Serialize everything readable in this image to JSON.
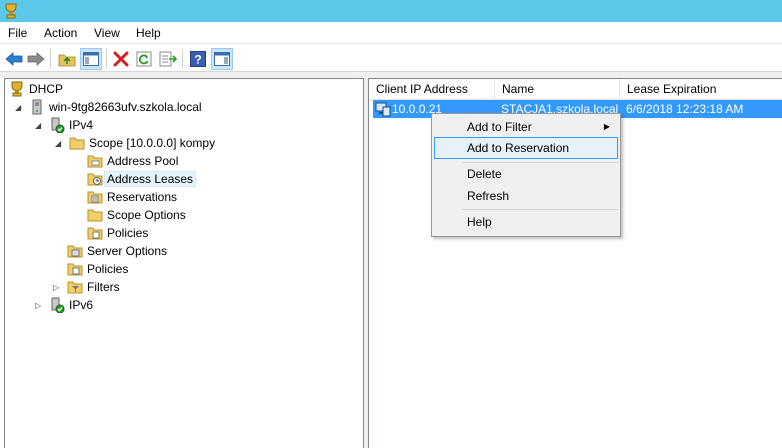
{
  "menubar": {
    "items": [
      "File",
      "Action",
      "View",
      "Help"
    ]
  },
  "toolbar": {
    "buttons": [
      "back-arrow-icon",
      "forward-arrow-icon",
      "up-folder-icon",
      "show-hide-tree-icon",
      "delete-icon",
      "refresh-icon",
      "export-list-icon",
      "help-icon",
      "action-pane-icon"
    ]
  },
  "tree": {
    "root": "DHCP",
    "server": "win-9tg82663ufv.szkola.local",
    "ipv4": "IPv4",
    "scope": "Scope [10.0.0.0] kompy",
    "address_pool": "Address Pool",
    "address_leases": "Address Leases",
    "reservations": "Reservations",
    "scope_options": "Scope Options",
    "scope_policies": "Policies",
    "server_options": "Server Options",
    "policies": "Policies",
    "filters": "Filters",
    "ipv6": "IPv6"
  },
  "list": {
    "columns": [
      "Client IP Address",
      "Name",
      "Lease Expiration"
    ],
    "rows": [
      {
        "ip": "10.0.0.21",
        "name": "STACJA1.szkola.local",
        "expiration": "6/6/2018 12:23:18 AM"
      }
    ]
  },
  "context_menu": {
    "add_to_filter": "Add to Filter",
    "add_to_reservation": "Add to Reservation",
    "delete": "Delete",
    "refresh": "Refresh",
    "help": "Help"
  },
  "colors": {
    "titlebar": "#5bc8ea",
    "selection": "#3399ff",
    "menu_hover": "#e5f1fb"
  }
}
